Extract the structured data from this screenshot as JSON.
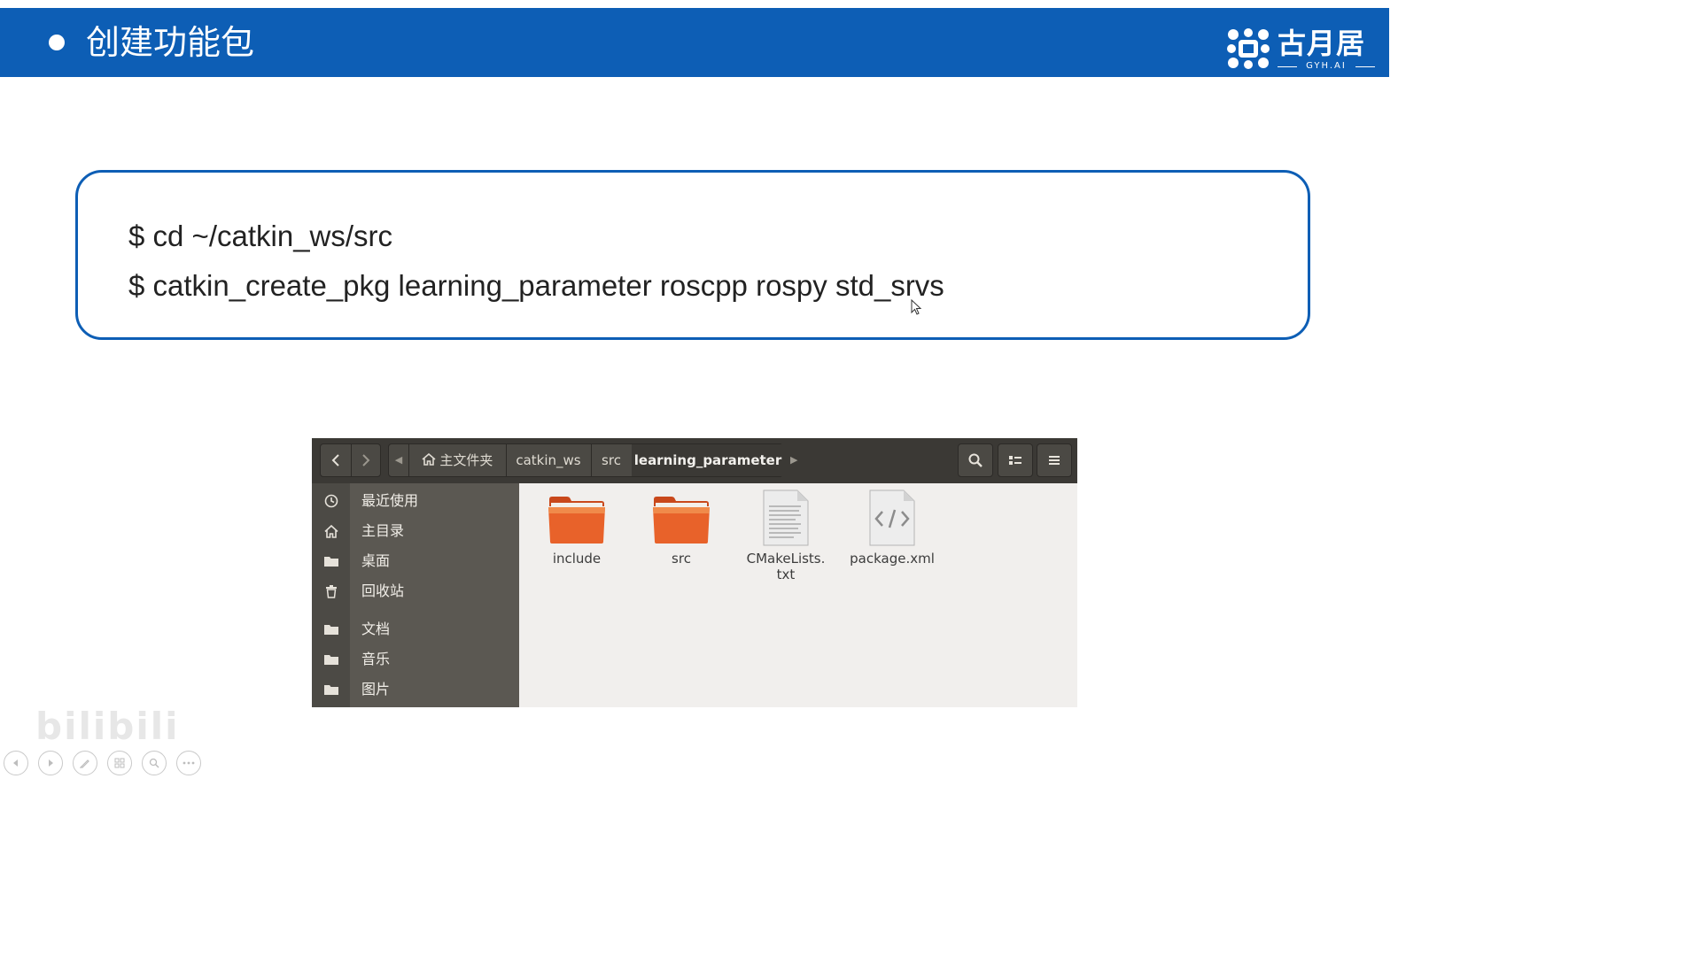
{
  "slide": {
    "title": "创建功能包",
    "logo": {
      "name": "古月居",
      "sub": "GYH.AI"
    },
    "commands": [
      "$ cd ~/catkin_ws/src",
      "$ catkin_create_pkg learning_parameter roscpp rospy std_srvs"
    ]
  },
  "file_manager": {
    "breadcrumbs": {
      "home": "主文件夹",
      "items": [
        "catkin_ws",
        "src"
      ],
      "current": "learning_parameter"
    },
    "sidebar": [
      {
        "label": "最近使用",
        "icon": "clock-icon"
      },
      {
        "label": "主目录",
        "icon": "home-icon"
      },
      {
        "label": "桌面",
        "icon": "folder-icon"
      },
      {
        "label": "回收站",
        "icon": "trash-icon"
      },
      {
        "label": "文档",
        "icon": "folder-icon"
      },
      {
        "label": "音乐",
        "icon": "folder-icon"
      },
      {
        "label": "图片",
        "icon": "folder-icon"
      }
    ],
    "files": [
      {
        "name": "include",
        "type": "folder"
      },
      {
        "name": "src",
        "type": "folder"
      },
      {
        "name": "CMakeLists.\ntxt",
        "type": "text"
      },
      {
        "name": "package.xml",
        "type": "xml"
      }
    ]
  },
  "colors": {
    "accent_blue": "#0d5eb5",
    "folder_orange": "#e8622a",
    "header_dark": "#3b3935",
    "sidebar": "#5b5852"
  },
  "overlay": {
    "watermark": "bilibili"
  }
}
